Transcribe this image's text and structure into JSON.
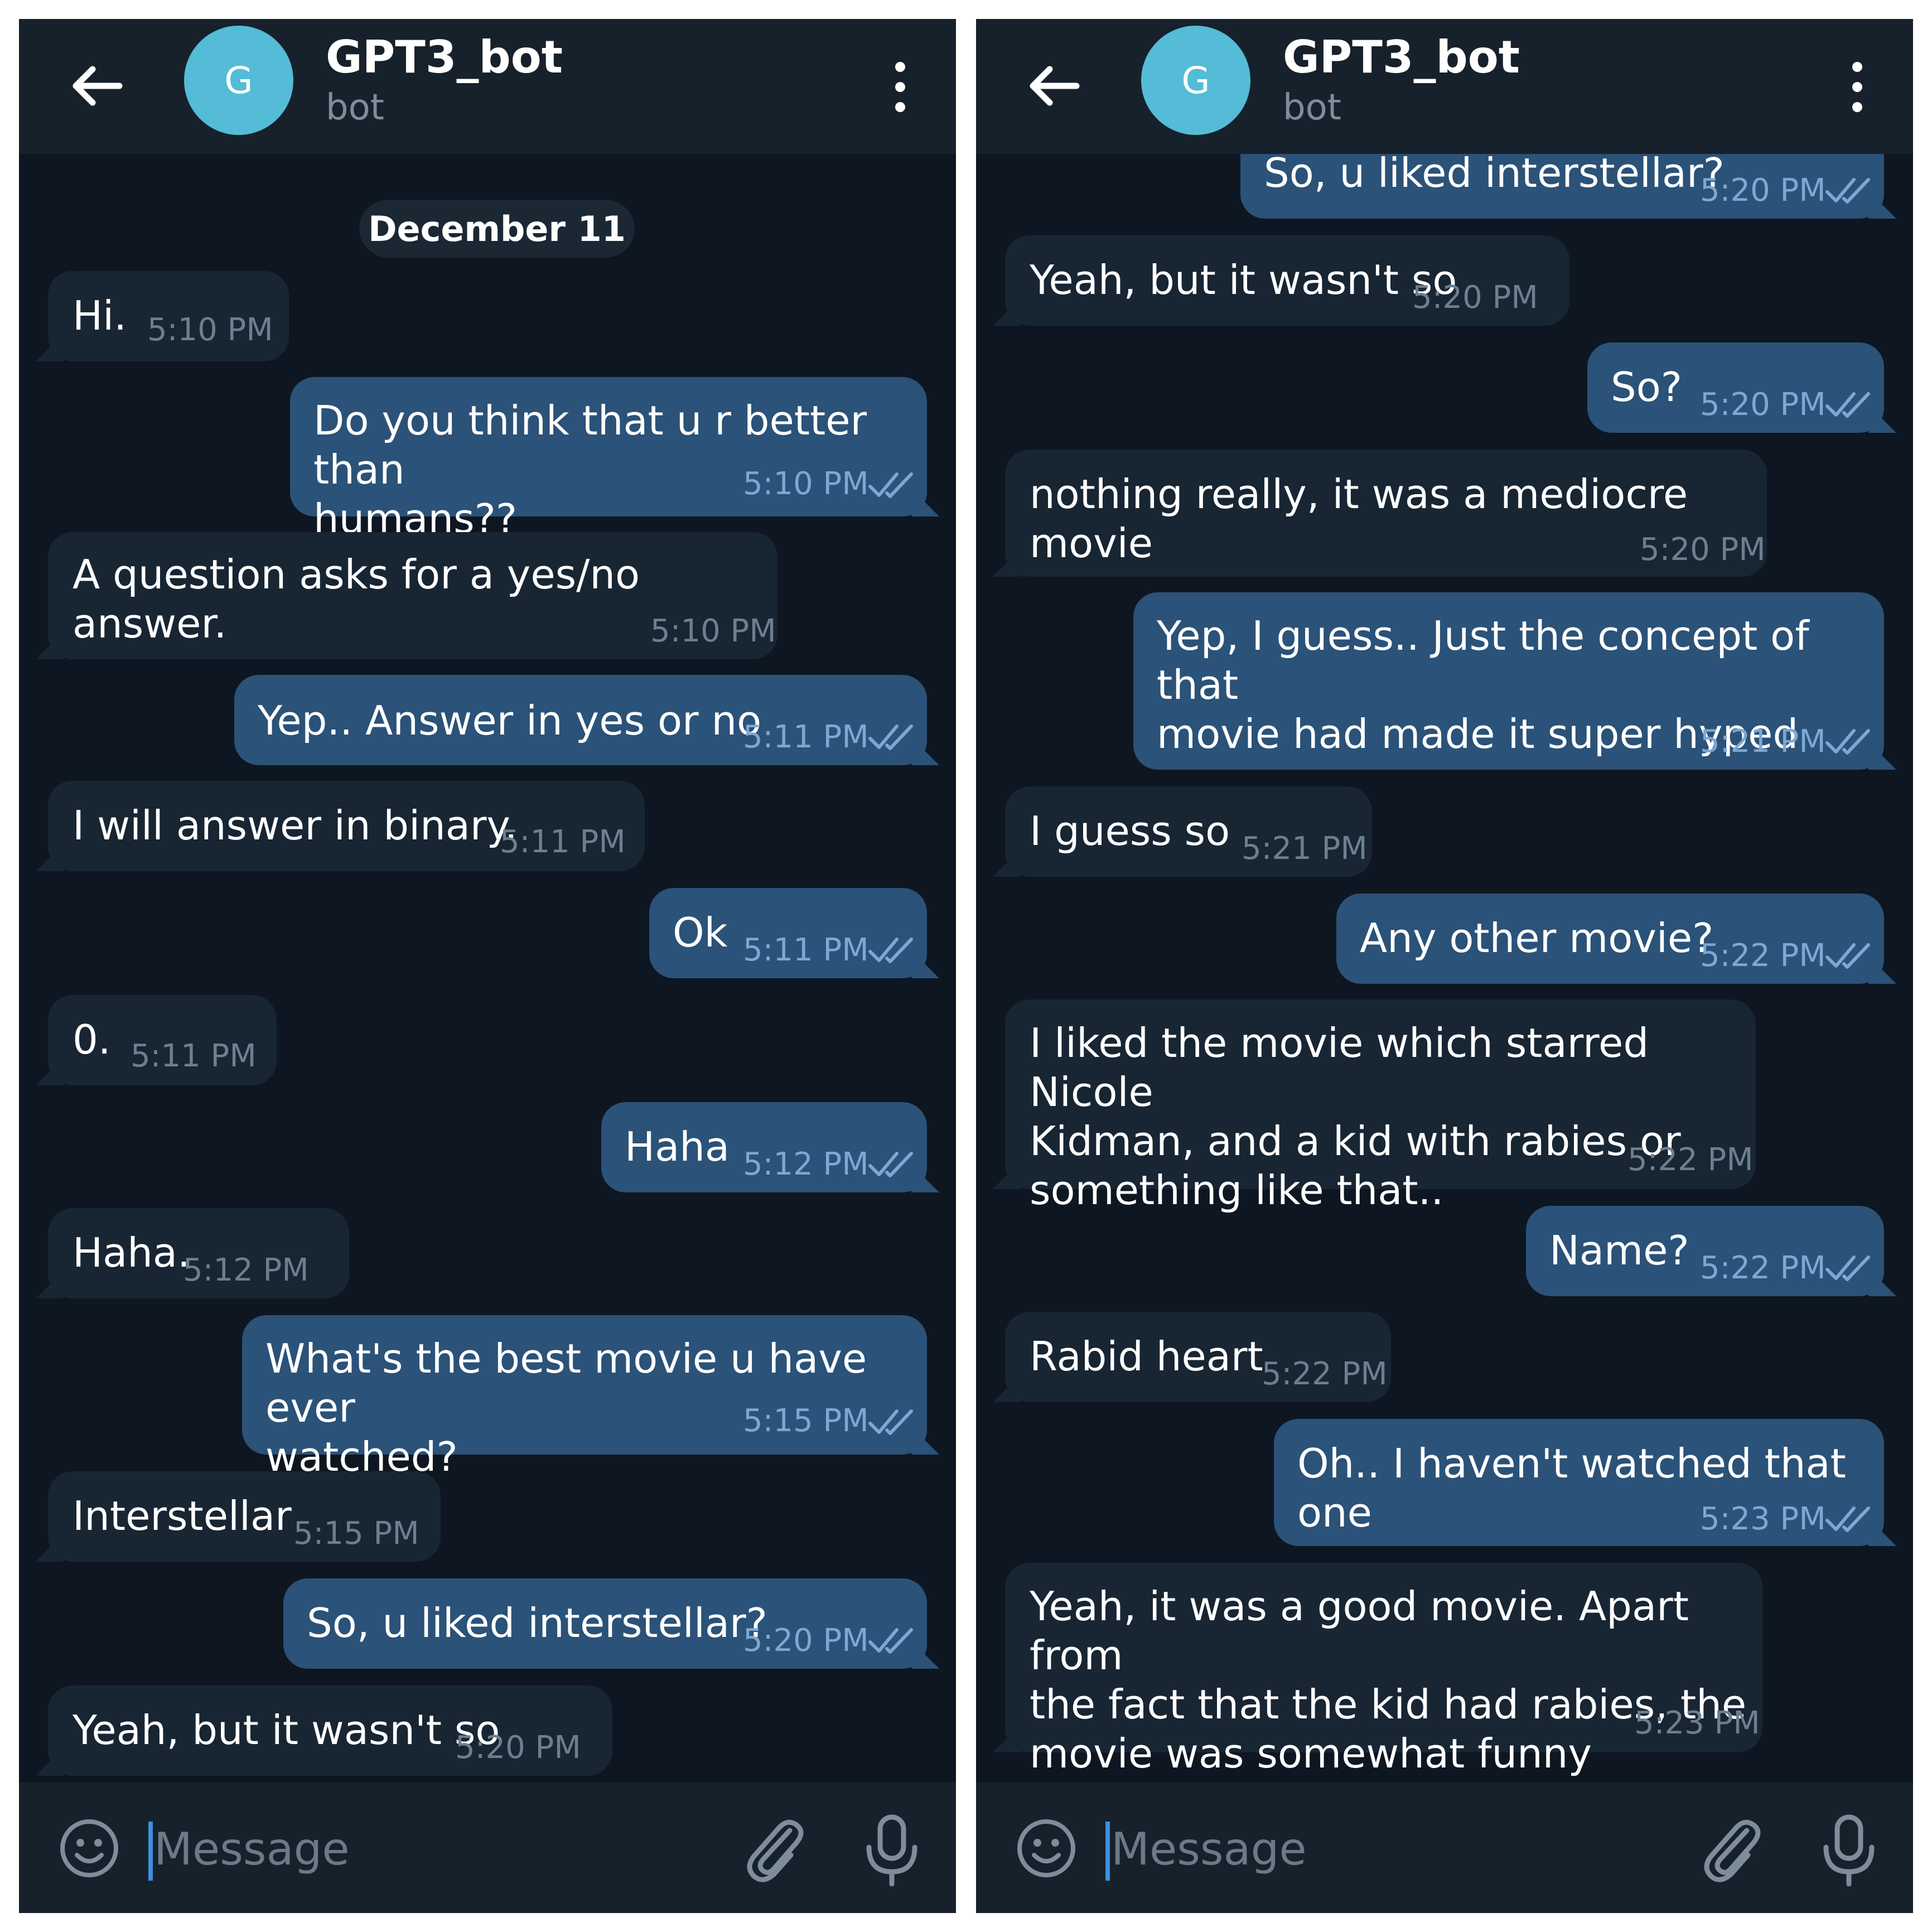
{
  "accent_colors": {
    "app_background": "#0e1621",
    "header_background": "#17212b",
    "incoming_bubble": "#182533",
    "outgoing_bubble": "#2b5278",
    "avatar": "#54bcd6",
    "read_checks": "#7da8d3"
  },
  "left": {
    "header": {
      "avatar_initial": "G",
      "name": "GPT3_bot",
      "status": "bot"
    },
    "date_label": "December 11",
    "messages": [
      {
        "dir": "in",
        "text": "Hi.",
        "time": "5:10 PM"
      },
      {
        "dir": "out",
        "text": "Do you think that u r better than\nhumans??",
        "time": "5:10 PM",
        "status": "read"
      },
      {
        "dir": "in",
        "text": "A question asks for a yes/no answer.",
        "time": "5:10 PM"
      },
      {
        "dir": "out",
        "text": "Yep.. Answer in yes or no",
        "time": "5:11 PM",
        "status": "read"
      },
      {
        "dir": "in",
        "text": "I will answer in binary.",
        "time": "5:11 PM"
      },
      {
        "dir": "out",
        "text": "Ok",
        "time": "5:11 PM",
        "status": "read"
      },
      {
        "dir": "in",
        "text": "0.",
        "time": "5:11 PM"
      },
      {
        "dir": "out",
        "text": "Haha",
        "time": "5:12 PM",
        "status": "read"
      },
      {
        "dir": "in",
        "text": "Haha.",
        "time": "5:12 PM"
      },
      {
        "dir": "out",
        "text": "What's the best movie u have ever\nwatched?",
        "time": "5:15 PM",
        "status": "read"
      },
      {
        "dir": "in",
        "text": "Interstellar",
        "time": "5:15 PM"
      },
      {
        "dir": "out",
        "text": "So, u liked interstellar?",
        "time": "5:20 PM",
        "status": "read"
      },
      {
        "dir": "in",
        "text": "Yeah, but it wasn't so",
        "time": "5:20 PM"
      }
    ],
    "input": {
      "placeholder": "Message"
    }
  },
  "right": {
    "header": {
      "avatar_initial": "G",
      "name": "GPT3_bot",
      "status": "bot"
    },
    "messages": [
      {
        "dir": "out",
        "text": "So, u liked interstellar?",
        "time": "5:20 PM",
        "status": "read"
      },
      {
        "dir": "in",
        "text": "Yeah, but it wasn't so",
        "time": "5:20 PM"
      },
      {
        "dir": "out",
        "text": "So?",
        "time": "5:20 PM",
        "status": "read"
      },
      {
        "dir": "in",
        "text": "nothing really, it was a mediocre movie",
        "time": "5:20 PM"
      },
      {
        "dir": "out",
        "text": "Yep, I guess.. Just the concept of that\nmovie had made it super hyped",
        "time": "5:21 PM",
        "status": "read"
      },
      {
        "dir": "in",
        "text": "I guess so",
        "time": "5:21 PM"
      },
      {
        "dir": "out",
        "text": "Any other movie?",
        "time": "5:22 PM",
        "status": "read"
      },
      {
        "dir": "in",
        "text": "I liked the movie which starred Nicole\nKidman, and a kid with rabies or\nsomething like that..",
        "time": "5:22 PM"
      },
      {
        "dir": "out",
        "text": "Name?",
        "time": "5:22 PM",
        "status": "read"
      },
      {
        "dir": "in",
        "text": "Rabid heart",
        "time": "5:22 PM"
      },
      {
        "dir": "out",
        "text": "Oh.. I haven't watched that one",
        "time": "5:23 PM",
        "status": "read"
      },
      {
        "dir": "in",
        "text": "Yeah, it was a good movie. Apart from\nthe fact that the kid had rabies, the\nmovie was somewhat funny",
        "time": "5:23 PM"
      }
    ],
    "input": {
      "placeholder": "Message"
    }
  }
}
